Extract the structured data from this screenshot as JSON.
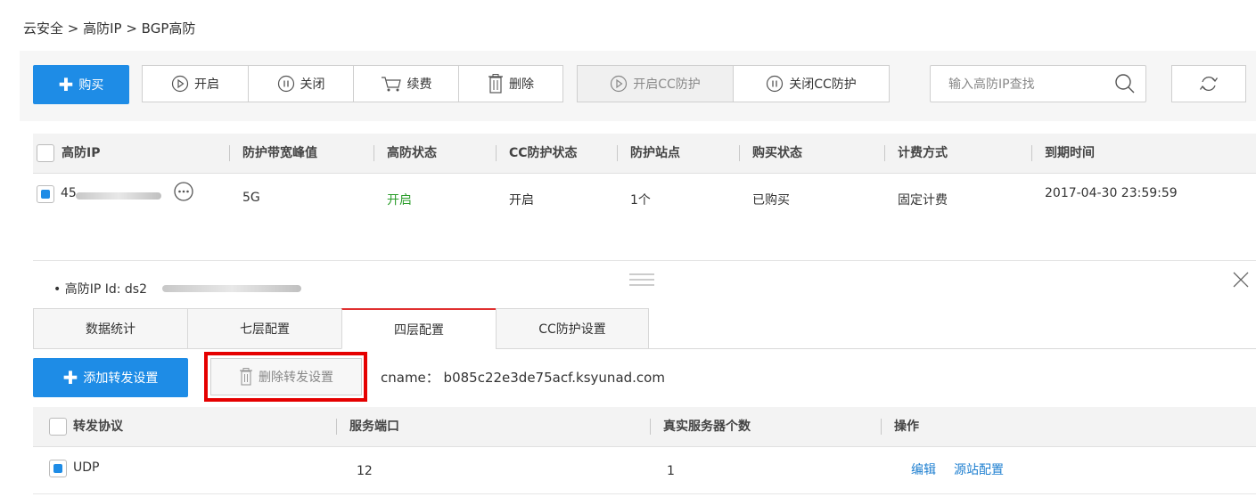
{
  "breadcrumb": "云安全 > 高防IP > BGP高防",
  "toolbar": {
    "buy": "购买",
    "start": "开启",
    "stop": "关闭",
    "renew": "续费",
    "delete": "删除",
    "cc_on": "开启CC防护",
    "cc_off": "关闭CC防护",
    "search_placeholder": "输入高防IP查找"
  },
  "table": {
    "headers": [
      "高防IP",
      "防护带宽峰值",
      "高防状态",
      "CC防护状态",
      "防护站点",
      "购买状态",
      "计费方式",
      "到期时间"
    ],
    "row": {
      "ip": "45",
      "bandwidth": "5G",
      "status": "开启",
      "cc_status": "开启",
      "sites": "1个",
      "purchase": "已购买",
      "billing": "固定计费",
      "expire": "2017-04-30 23:59:59"
    }
  },
  "detail": {
    "id_label": "• 高防IP Id: ds2",
    "tabs": [
      "数据统计",
      "七层配置",
      "四层配置",
      "CC防护设置"
    ],
    "add_btn": "添加转发设置",
    "del_btn": "删除转发设置",
    "cname": "cname： b085c22e3de75acf.ksyunad.com",
    "headers": [
      "转发协议",
      "服务端口",
      "真实服务器个数",
      "操作"
    ],
    "row": {
      "protocol": "UDP",
      "port": "12",
      "servers": "1",
      "edit": "编辑",
      "origin": "源站配置"
    }
  },
  "colors": {
    "primary": "#1e8ce6",
    "active_status": "#2a9d2a",
    "highlight": "#e50000",
    "link": "#1e7fd0"
  }
}
